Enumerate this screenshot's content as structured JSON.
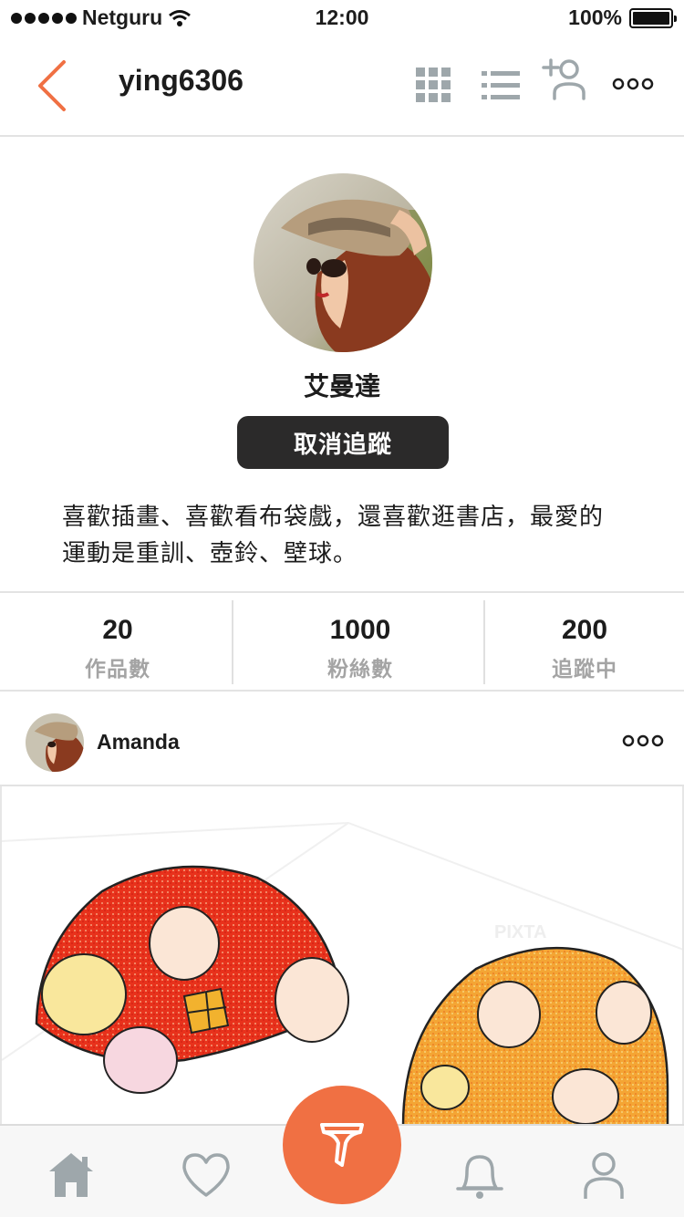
{
  "status_bar": {
    "carrier": "Netguru",
    "time": "12:00",
    "battery": "100%"
  },
  "header": {
    "username": "ying6306",
    "icons": [
      "back-chevron-icon",
      "grid-view-icon",
      "list-view-icon",
      "add-friend-icon",
      "more-icon"
    ]
  },
  "profile": {
    "display_name": "艾曼達",
    "unfollow_label": "取消追蹤",
    "bio_line1": "喜歡插畫、喜歡看布袋戲，還喜歡逛書店，最愛的",
    "bio_line2": "運動是重訓、壺鈴、壁球。"
  },
  "stats": [
    {
      "value": "20",
      "label": "作品數"
    },
    {
      "value": "1000",
      "label": "粉絲數"
    },
    {
      "value": "200",
      "label": "追蹤中"
    }
  ],
  "post": {
    "author": "Amanda",
    "watermark": "PIXTA"
  },
  "tab_bar": {
    "icons": [
      "home-icon",
      "heart-icon",
      "brush-icon",
      "bell-icon",
      "profile-icon"
    ]
  },
  "colors": {
    "accent": "#f07043",
    "button_dark": "#2b2a2a",
    "icon_gray": "#9ea7ab",
    "muted_text": "#a4a4a4"
  }
}
